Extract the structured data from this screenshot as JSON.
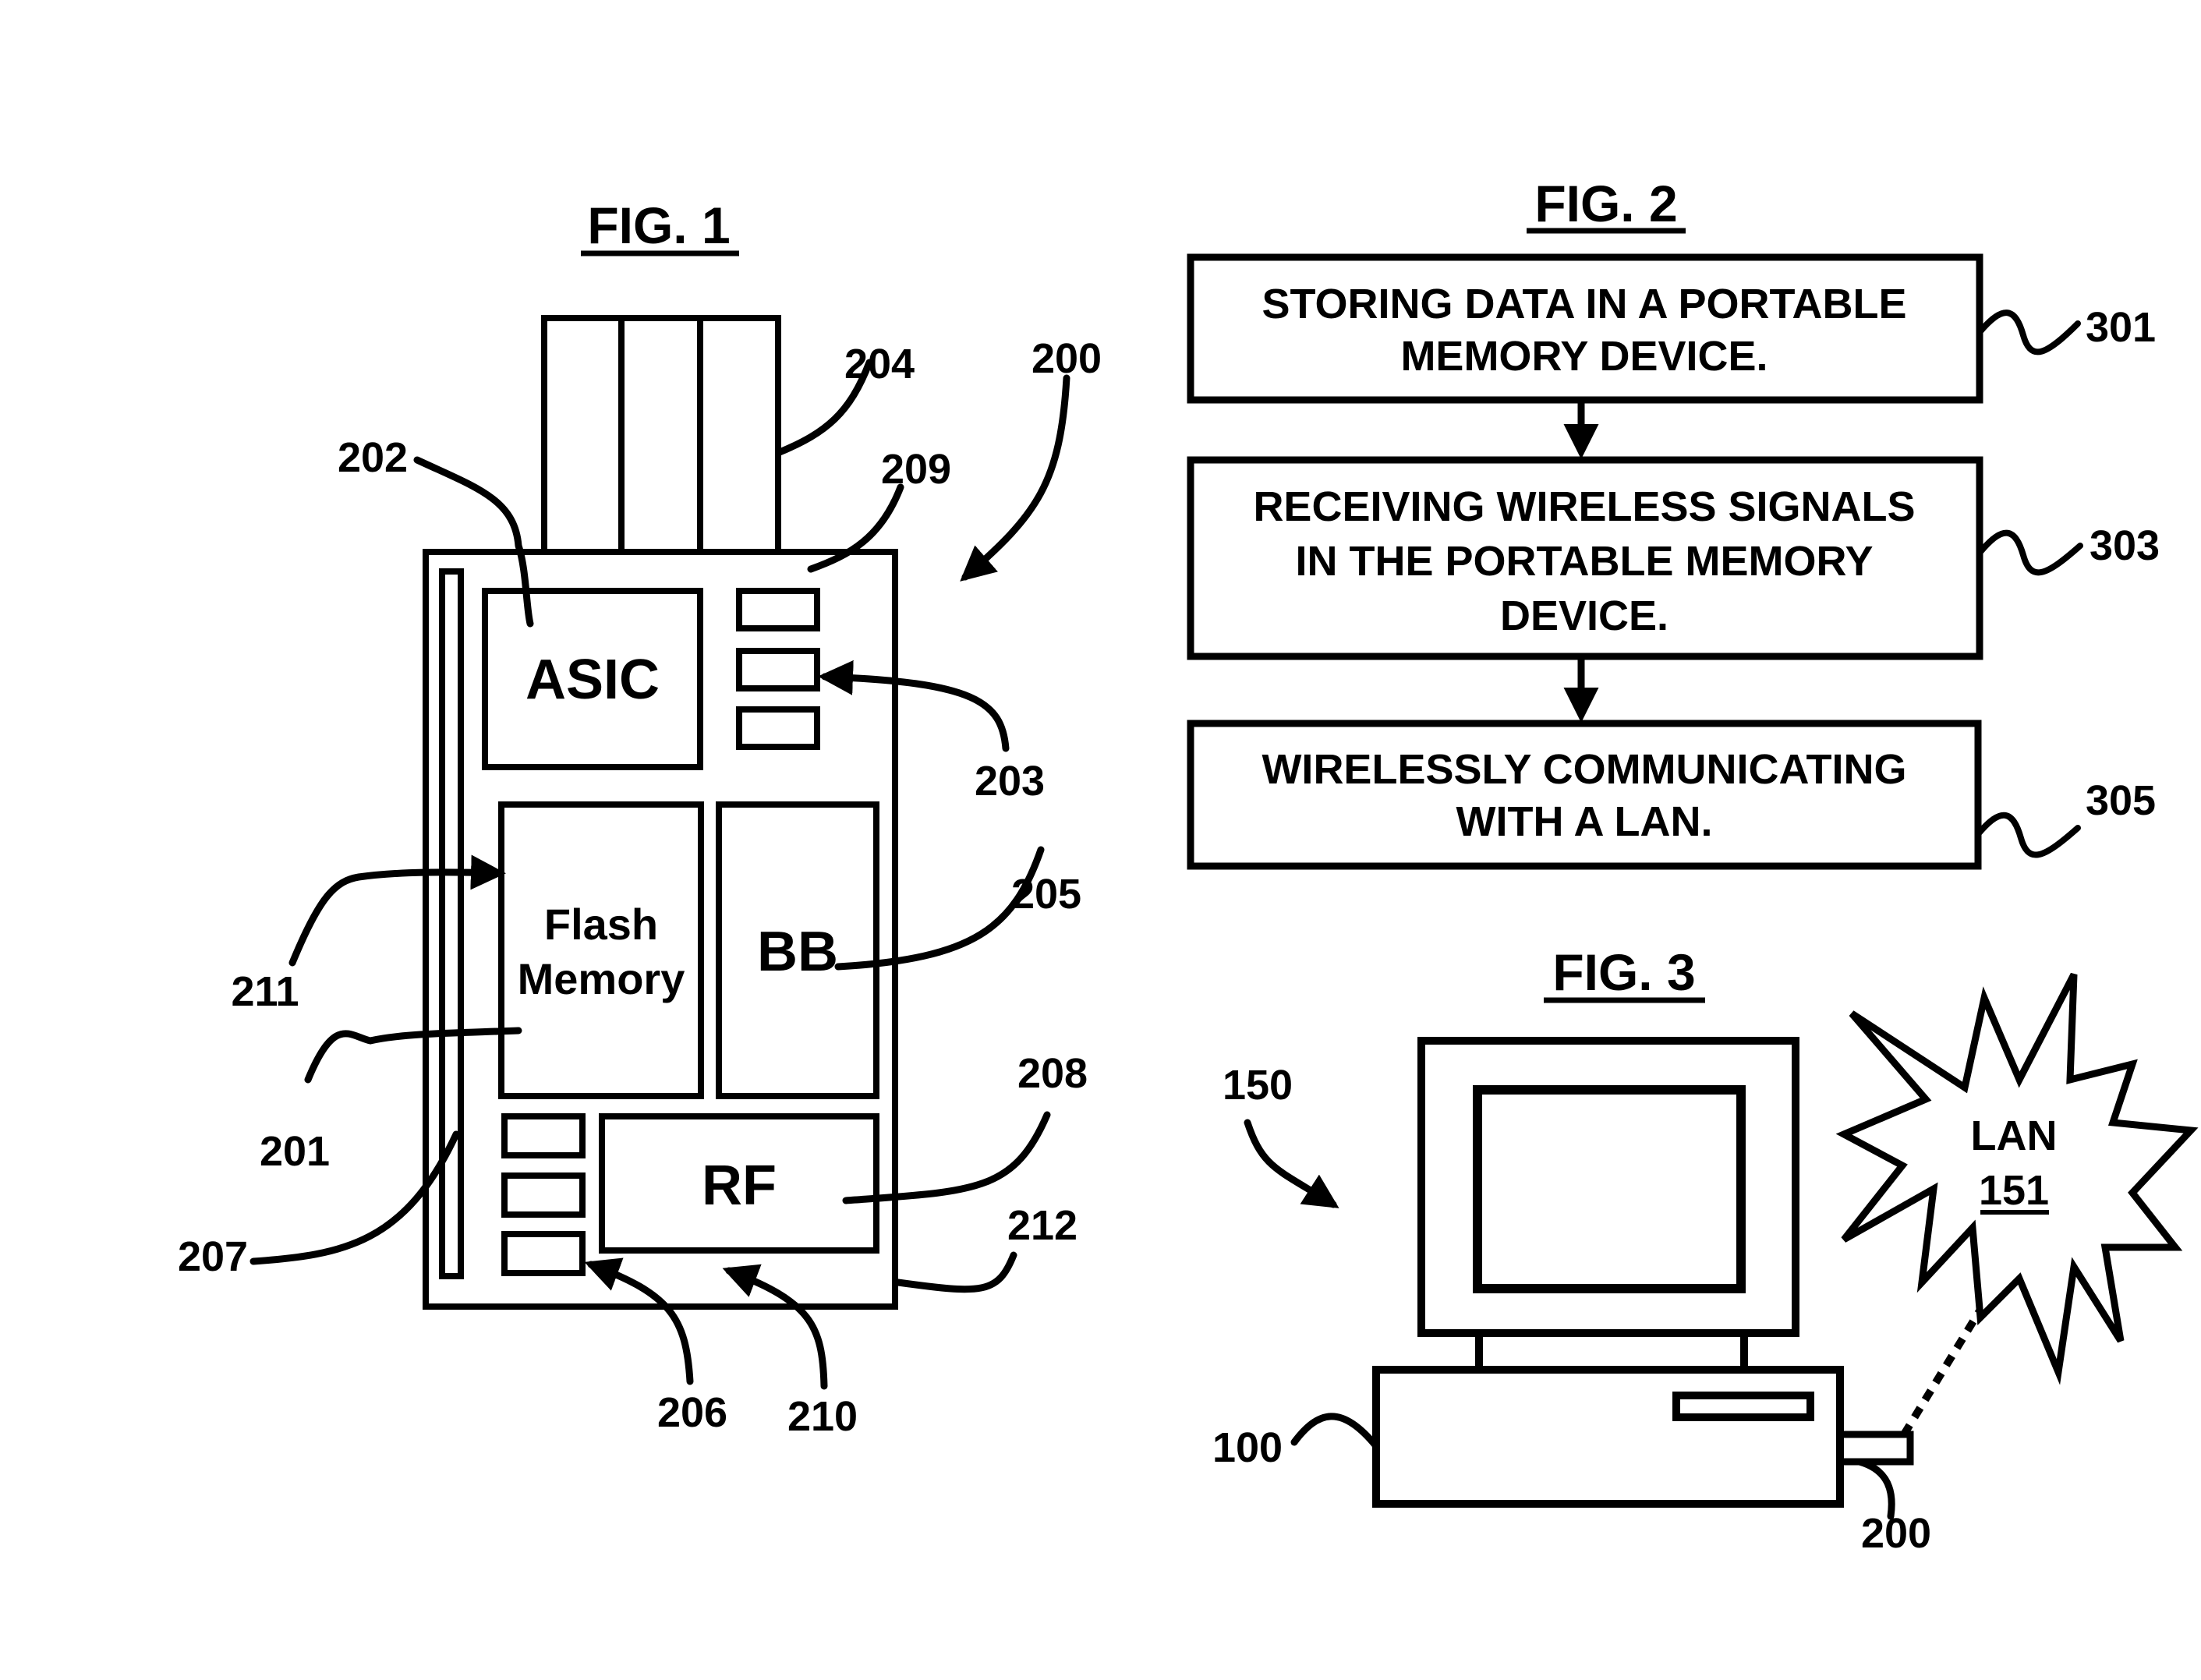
{
  "fig1": {
    "title": "FIG. 1",
    "blocks": {
      "asic": "ASIC",
      "flash_line1": "Flash",
      "flash_line2": "Memory",
      "bb": "BB",
      "rf": "RF"
    },
    "refs": {
      "r200": "200",
      "r201": "201",
      "r202": "202",
      "r203": "203",
      "r204": "204",
      "r205": "205",
      "r206": "206",
      "r207": "207",
      "r208": "208",
      "r209": "209",
      "r210": "210",
      "r211": "211",
      "r212": "212"
    }
  },
  "fig2": {
    "title": "FIG. 2",
    "steps": [
      {
        "ref": "301",
        "lines": [
          "STORING DATA IN A PORTABLE",
          "MEMORY DEVICE."
        ]
      },
      {
        "ref": "303",
        "lines": [
          "RECEIVING WIRELESS SIGNALS",
          "IN THE PORTABLE MEMORY",
          "DEVICE."
        ]
      },
      {
        "ref": "305",
        "lines": [
          "WIRELESSLY COMMUNICATING",
          "WITH A LAN."
        ]
      }
    ]
  },
  "fig3": {
    "title": "FIG. 3",
    "lan_label": "LAN",
    "lan_ref": "151",
    "refs": {
      "system": "150",
      "computer": "100",
      "device": "200"
    }
  }
}
